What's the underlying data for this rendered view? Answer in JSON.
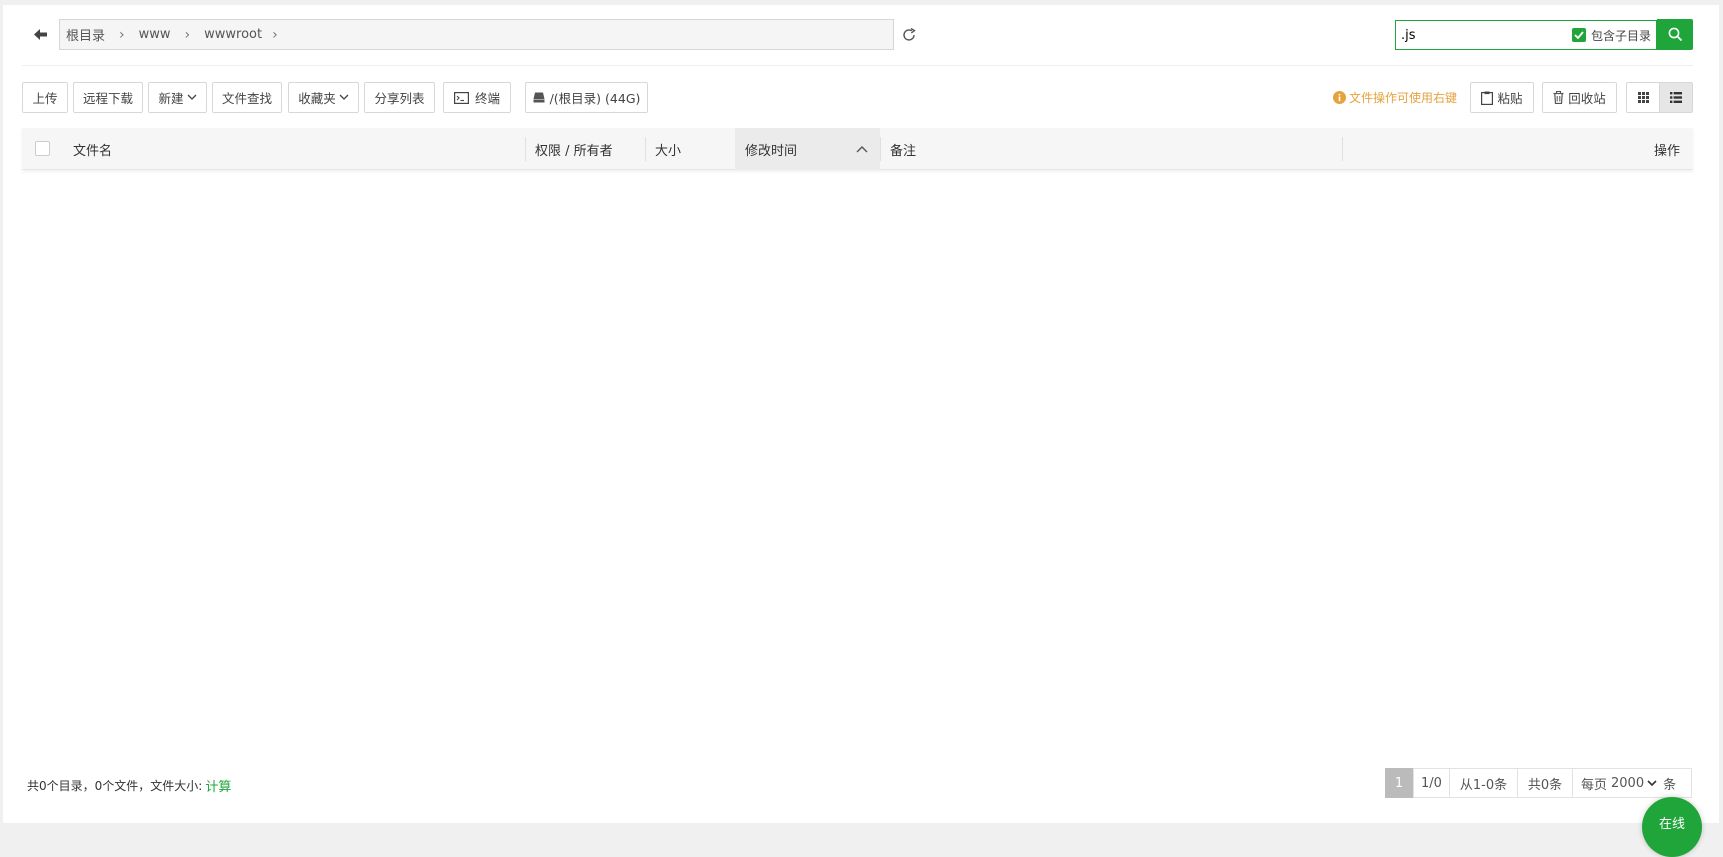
{
  "breadcrumb": {
    "items": [
      "根目录",
      "www",
      "wwwroot"
    ]
  },
  "search": {
    "value": ".js",
    "include_subdir_label": "包含子目录",
    "include_subdir_checked": true
  },
  "toolbar": {
    "upload": "上传",
    "remote_download": "远程下载",
    "new": "新建",
    "find_file": "文件查找",
    "favorites": "收藏夹",
    "share_list": "分享列表",
    "terminal": "终端",
    "disk": "/(根目录) (44G)",
    "hint": "文件操作可使用右键",
    "paste": "粘贴",
    "recycle_bin": "回收站"
  },
  "table": {
    "columns": {
      "filename": "文件名",
      "permission": "权限 / 所有者",
      "size": "大小",
      "mtime": "修改时间",
      "remark": "备注",
      "actions": "操作"
    }
  },
  "footer": {
    "summary": "共0个目录，0个文件，文件大小:",
    "calc_link": "计算"
  },
  "pagination": {
    "current": "1",
    "ratio": "1/0",
    "range": "从1-0条",
    "total": "共0条",
    "per_page_label": "每页",
    "per_page_value": "2000",
    "unit": "条"
  },
  "online": {
    "label": "在线"
  },
  "colors": {
    "accent": "#20a53a",
    "hint": "#e6a23c"
  }
}
